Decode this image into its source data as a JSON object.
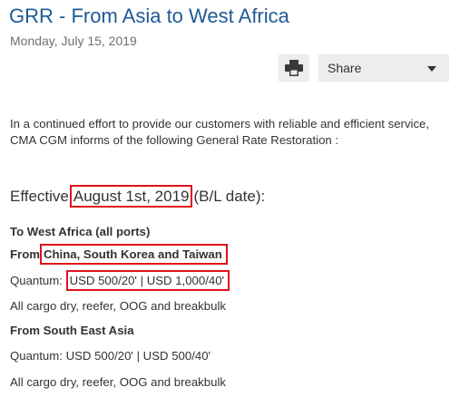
{
  "article": {
    "title": "GRR - From Asia to West Africa",
    "date": "Monday, July 15, 2019"
  },
  "toolbar": {
    "print_icon": "printer-icon",
    "share_label": "Share",
    "share_icon": "chevron-down-icon"
  },
  "body": {
    "intro": "In a continued effort to provide our customers with reliable and efficient service, CMA CGM informs of the following General Rate Restoration :",
    "effective_prefix": "Effective",
    "effective_date": "August 1st, 2019",
    "effective_suffix": "(B/L date):",
    "section1_heading": "To West Africa (all ports)",
    "section1_from_prefix": "From",
    "section1_from_countries": "China, South Korea and Taiwan",
    "section1_quantum_label": "Quantum:",
    "section1_quantum_value": "USD 500/20' | USD 1,000/40'",
    "section1_cargo": "All cargo dry, reefer, OOG and breakbulk",
    "section2_heading": "From South East Asia",
    "section2_quantum": "Quantum: USD 500/20' | USD 500/40'",
    "section2_cargo": "All cargo dry, reefer, OOG and breakbulk"
  },
  "colors": {
    "title": "#1f5a96",
    "highlight_box": "#e0121b",
    "button_bg": "#ededed"
  }
}
